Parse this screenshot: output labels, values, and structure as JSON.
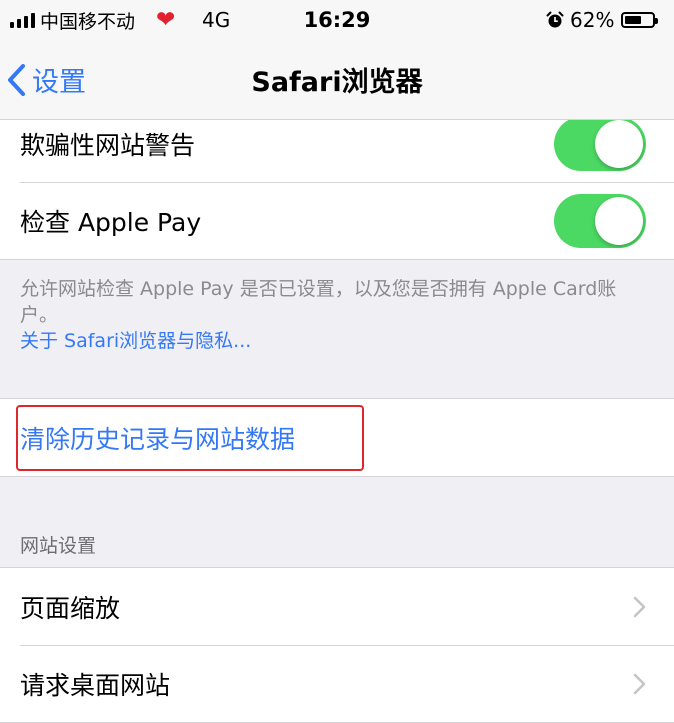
{
  "status_bar": {
    "carrier": "中国移不动",
    "network": "4G",
    "time": "16:29",
    "battery_percent": "62%",
    "battery_level": 0.62
  },
  "nav": {
    "back_label": "设置",
    "title": "Safari浏览器"
  },
  "settings": {
    "fraud_warning_label": "欺骗性网站警告",
    "fraud_warning_on": true,
    "apple_pay_label": "检查 Apple Pay",
    "apple_pay_on": true,
    "footer_text": "允许网站检查 Apple Pay 是否已设置，以及您是否拥有 Apple Card账户。",
    "footer_link": "关于 Safari浏览器与隐私..."
  },
  "actions": {
    "clear_history_label": "清除历史记录与网站数据"
  },
  "website_settings": {
    "header": "网站设置",
    "items": [
      {
        "label": "页面缩放"
      },
      {
        "label": "请求桌面网站"
      }
    ]
  },
  "colors": {
    "accent": "#3478f6",
    "toggle_on": "#4bd963",
    "highlight": "#e0262d",
    "heart": "#e1222e"
  }
}
